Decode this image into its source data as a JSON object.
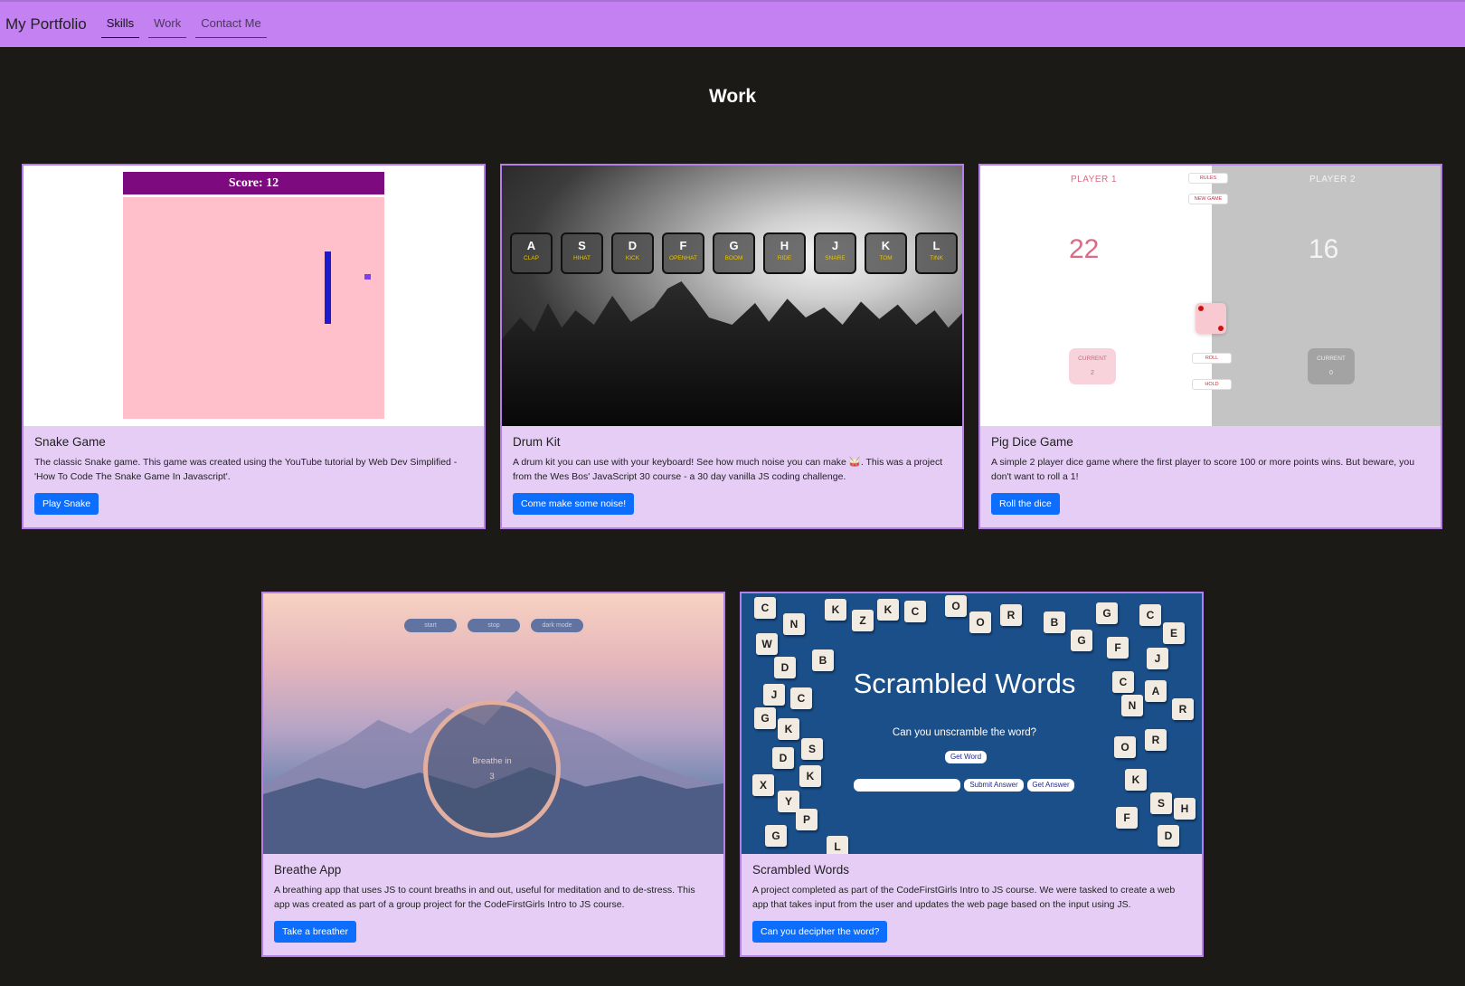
{
  "nav": {
    "brand": "My Portfolio",
    "links": [
      "Skills",
      "Work",
      "Contact Me"
    ]
  },
  "section_title": "Work",
  "cards": [
    {
      "title": "Snake Game",
      "text": "The classic Snake game. This game was created using the YouTube tutorial by Web Dev Simplified - 'How To Code The Snake Game In Javascript'.",
      "button": "Play Snake",
      "preview": {
        "score": "Score: 12"
      }
    },
    {
      "title": "Drum Kit",
      "text": "A drum kit you can use with your keyboard! See how much noise you can make 🥁. This was a project from the Wes Bos' JavaScript 30 course - a 30 day vanilla JS coding challenge.",
      "button": "Come make some noise!",
      "preview": {
        "keys": [
          {
            "key": "A",
            "sound": "CLAP"
          },
          {
            "key": "S",
            "sound": "HIHAT"
          },
          {
            "key": "D",
            "sound": "KICK"
          },
          {
            "key": "F",
            "sound": "OPENHAT"
          },
          {
            "key": "G",
            "sound": "BOOM"
          },
          {
            "key": "H",
            "sound": "RIDE"
          },
          {
            "key": "J",
            "sound": "SNARE"
          },
          {
            "key": "K",
            "sound": "TOM"
          },
          {
            "key": "L",
            "sound": "TINK"
          }
        ]
      }
    },
    {
      "title": "Pig Dice Game",
      "text": "A simple 2 player dice game where the first player to score 100 or more points wins. But beware, you don't want to roll a 1!",
      "button": "Roll the dice",
      "preview": {
        "player1": "PLAYER 1",
        "player2": "PLAYER 2",
        "score1": "22",
        "score2": "16",
        "current_label": "CURRENT",
        "current1": "2",
        "current2": "0",
        "rules": "RULES",
        "new_game": "NEW GAME",
        "roll": "ROLL",
        "hold": "HOLD"
      }
    },
    {
      "title": "Breathe App",
      "text": "A breathing app that uses JS to count breaths in and out, useful for meditation and to de-stress. This app was created as part of a group project for the CodeFirstGirls Intro to JS course.",
      "button": "Take a breather",
      "preview": {
        "start": "start",
        "stop": "stop",
        "dark": "dark mode",
        "breathe": "Breathe in",
        "count": "3"
      }
    },
    {
      "title": "Scrambled Words",
      "text": "A project completed as part of the CodeFirstGirls Intro to JS course. We were tasked to create a web app that takes input from the user and updates the web page based on the input using JS.",
      "button": "Can you decipher the word?",
      "preview": {
        "title": "Scrambled Words",
        "question": "Can you unscramble the word?",
        "get_word": "Get Word",
        "submit": "Submit Answer",
        "get_answer": "Get Answer"
      }
    }
  ],
  "colors": {
    "navbar": "#c381f2",
    "page_bg": "#1c1a16",
    "card_bg": "#e6cdf6",
    "card_border": "#b77ee8",
    "button": "#0d6efd"
  }
}
